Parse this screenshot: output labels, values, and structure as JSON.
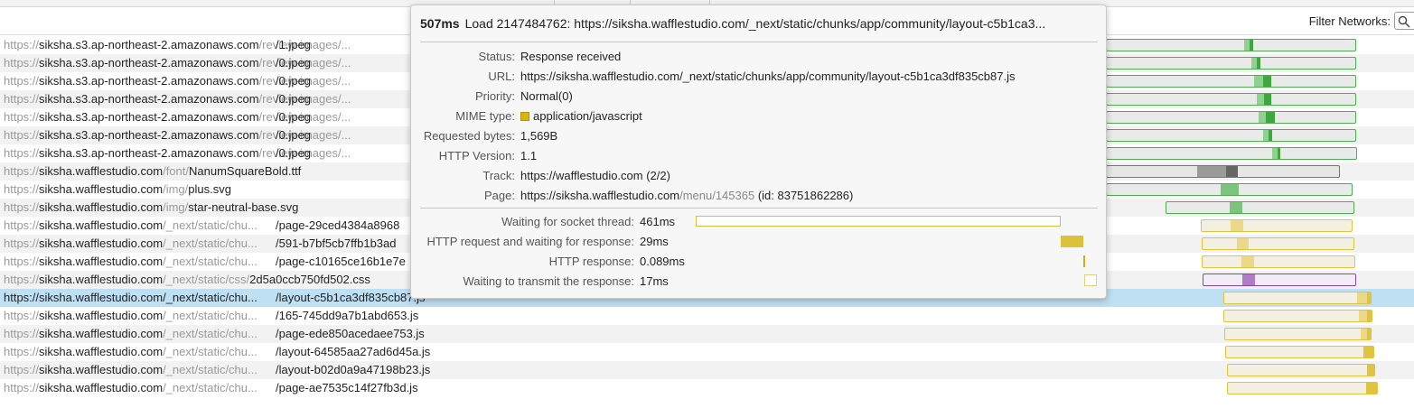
{
  "header": {
    "filter_label": "Filter Networks:"
  },
  "icons": {
    "search": "search-icon",
    "mime_swatch": "square-swatch"
  },
  "colors": {
    "selected_row": "#bfdff3",
    "image_bar": "#4caf50",
    "script_bar": "#e0c440",
    "css_bar": "#8e44ad",
    "font_bar": "#808080"
  },
  "rows": [
    {
      "scheme": "https://",
      "host": "siksha.s3.ap-northeast-2.amazonaws.com",
      "path": "/review-images/...",
      "file": "/1.jpeg"
    },
    {
      "scheme": "https://",
      "host": "siksha.s3.ap-northeast-2.amazonaws.com",
      "path": "/review-images/...",
      "file": "/0.jpeg"
    },
    {
      "scheme": "https://",
      "host": "siksha.s3.ap-northeast-2.amazonaws.com",
      "path": "/review-images/...",
      "file": "/0.jpeg"
    },
    {
      "scheme": "https://",
      "host": "siksha.s3.ap-northeast-2.amazonaws.com",
      "path": "/review-images/...",
      "file": "/0.jpeg"
    },
    {
      "scheme": "https://",
      "host": "siksha.s3.ap-northeast-2.amazonaws.com",
      "path": "/review-images/...",
      "file": "/0.jpeg"
    },
    {
      "scheme": "https://",
      "host": "siksha.s3.ap-northeast-2.amazonaws.com",
      "path": "/review-images/...",
      "file": "/0.jpeg"
    },
    {
      "scheme": "https://",
      "host": "siksha.s3.ap-northeast-2.amazonaws.com",
      "path": "/review-images/...",
      "file": "/0.jpeg"
    },
    {
      "scheme": "https://",
      "host": "siksha.wafflestudio.com",
      "path": "/font/",
      "file": "NanumSquareBold.ttf"
    },
    {
      "scheme": "https://",
      "host": "siksha.wafflestudio.com",
      "path": "/img/",
      "file": "plus.svg"
    },
    {
      "scheme": "https://",
      "host": "siksha.wafflestudio.com",
      "path": "/img/",
      "file": "star-neutral-base.svg"
    },
    {
      "scheme": "https://",
      "host": "siksha.wafflestudio.com",
      "path": "/_next/static/chu...",
      "file": "/page-29ced4384a8968"
    },
    {
      "scheme": "https://",
      "host": "siksha.wafflestudio.com",
      "path": "/_next/static/chu...",
      "file": "/591-b7bf5cb7ffb1b3ad"
    },
    {
      "scheme": "https://",
      "host": "siksha.wafflestudio.com",
      "path": "/_next/static/chu...",
      "file": "/page-c10165ce16b1e7e"
    },
    {
      "scheme": "https://",
      "host": "siksha.wafflestudio.com",
      "path": "/_next/static/css/",
      "file": "2d5a0ccb750fd502.css"
    },
    {
      "scheme": "https://",
      "host": "siksha.wafflestudio.com",
      "path": "/_next/static/chu...",
      "file": "/layout-c5b1ca3df835cb87.js"
    },
    {
      "scheme": "https://",
      "host": "siksha.wafflestudio.com",
      "path": "/_next/static/chu...",
      "file": "/165-745dd9a7b1abd653.js"
    },
    {
      "scheme": "https://",
      "host": "siksha.wafflestudio.com",
      "path": "/_next/static/chu...",
      "file": "/page-ede850acedaee753.js"
    },
    {
      "scheme": "https://",
      "host": "siksha.wafflestudio.com",
      "path": "/_next/static/chu...",
      "file": "/layout-64585aa27ad6d45a.js"
    },
    {
      "scheme": "https://",
      "host": "siksha.wafflestudio.com",
      "path": "/_next/static/chu...",
      "file": "/layout-b02d0a9a47198b23.js"
    },
    {
      "scheme": "https://",
      "host": "siksha.wafflestudio.com",
      "path": "/_next/static/chu...",
      "file": "/page-ae7535c14f27fb3d.js"
    }
  ],
  "tooltip": {
    "duration": "507ms",
    "title": "Load 2147484762: https://siksha.wafflestudio.com/_next/static/chunks/app/community/layout-c5b1ca3...",
    "status_label": "Status:",
    "status": "Response received",
    "url_label": "URL:",
    "url": "https://siksha.wafflestudio.com/_next/static/chunks/app/community/layout-c5b1ca3df835cb87.js",
    "priority_label": "Priority:",
    "priority": "Normal(0)",
    "mime_label": "MIME type:",
    "mime": "application/javascript",
    "bytes_label": "Requested bytes:",
    "bytes": "1,569B",
    "http_version_label": "HTTP Version:",
    "http_version": "1.1",
    "track_label": "Track:",
    "track": "https://wafflestudio.com (2/2)",
    "page_label": "Page:",
    "page_host": "https://siksha.wafflestudio.com",
    "page_path": "/menu/145365",
    "page_id": " (id: 83751862286)",
    "timings": [
      {
        "label": "Waiting for socket thread:",
        "value": "461ms"
      },
      {
        "label": "HTTP request and waiting for response:",
        "value": "29ms"
      },
      {
        "label": "HTTP response:",
        "value": "0.089ms"
      },
      {
        "label": "Waiting to transmit the response:",
        "value": "17ms"
      }
    ]
  }
}
